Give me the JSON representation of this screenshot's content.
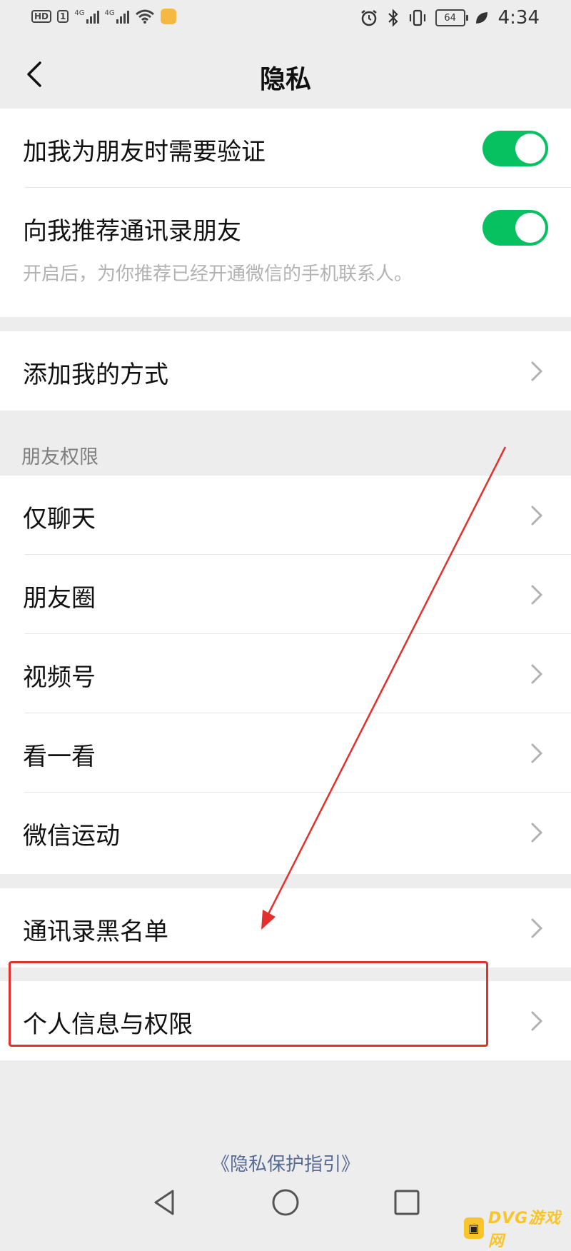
{
  "status_bar": {
    "left_icons": [
      "hd-icon",
      "sim1-icon",
      "signal-4g-icon",
      "signal-4g-icon",
      "wifi-icon",
      "app-notification-icon"
    ],
    "hd_label": "HD",
    "sim_label": "1",
    "net_label_1": "4G",
    "net_label_2": "4G",
    "right_icons": [
      "alarm-icon",
      "bluetooth-icon",
      "vibrate-icon",
      "battery-icon",
      "leaf-icon"
    ],
    "battery": "64",
    "time": "4:34"
  },
  "nav": {
    "back_icon": "chevron-left-icon",
    "title": "隐私"
  },
  "verification_group": {
    "items": [
      {
        "label": "加我为朋友时需要验证",
        "toggle_on": true
      },
      {
        "label": "向我推荐通讯录朋友",
        "toggle_on": true
      }
    ],
    "description": "开启后，为你推荐已经开通微信的手机联系人。"
  },
  "add_me_group": {
    "label": "添加我的方式"
  },
  "friend_permissions": {
    "header": "朋友权限",
    "items": [
      "仅聊天",
      "朋友圈",
      "视频号",
      "看一看",
      "微信运动"
    ]
  },
  "blacklist_group": {
    "label": "通讯录黑名单"
  },
  "personal_group": {
    "label": "个人信息与权限"
  },
  "footer": {
    "link": "《隐私保护指引》"
  },
  "colors": {
    "toggle_on": "#07c160",
    "annotation": "#e3302c",
    "link": "#576b95",
    "background": "#ededed"
  },
  "system_nav": [
    "triangle-back-icon",
    "circle-home-icon",
    "square-recents-icon"
  ],
  "watermark": {
    "text": "DVG游戏网"
  }
}
